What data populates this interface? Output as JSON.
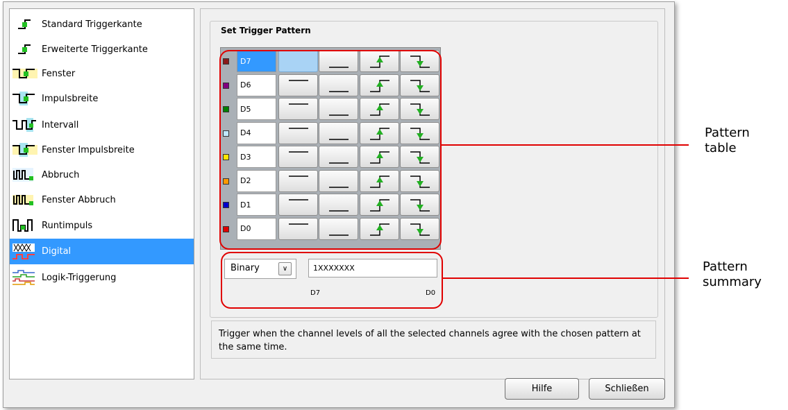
{
  "trigger_types": [
    {
      "label": "Standard Triggerkante",
      "icon": "standard-edge-icon"
    },
    {
      "label": "Erweiterte Triggerkante",
      "icon": "advanced-edge-icon"
    },
    {
      "label": "Fenster",
      "icon": "window-icon"
    },
    {
      "label": "Impulsbreite",
      "icon": "pulse-width-icon"
    },
    {
      "label": "Intervall",
      "icon": "interval-icon"
    },
    {
      "label": "Fenster Impulsbreite",
      "icon": "window-pulse-width-icon"
    },
    {
      "label": "Abbruch",
      "icon": "dropout-icon"
    },
    {
      "label": "Fenster Abbruch",
      "icon": "window-dropout-icon"
    },
    {
      "label": "Runtimpuls",
      "icon": "runt-pulse-icon"
    },
    {
      "label": "Digital",
      "icon": "digital-icon",
      "selected": true
    },
    {
      "label": "Logik-Triggerung",
      "icon": "logic-trigger-icon"
    }
  ],
  "pattern": {
    "group_title": "Set Trigger Pattern",
    "channels": [
      {
        "name": "D7",
        "color": "#8b1a1a",
        "selected": true,
        "state": "high-blank"
      },
      {
        "name": "D6",
        "color": "#800080"
      },
      {
        "name": "D5",
        "color": "#008000"
      },
      {
        "name": "D4",
        "color": "#c0e8ff"
      },
      {
        "name": "D3",
        "color": "#ffe600"
      },
      {
        "name": "D2",
        "color": "#ff9900"
      },
      {
        "name": "D1",
        "color": "#0000cc"
      },
      {
        "name": "D0",
        "color": "#e00000"
      }
    ],
    "button_icons": [
      "high-level-icon",
      "low-level-icon",
      "rising-edge-icon",
      "falling-edge-icon"
    ]
  },
  "summary": {
    "format": "Binary",
    "value": "1XXXXXXX",
    "msb_label": "D7",
    "lsb_label": "D0"
  },
  "description": "Trigger when the channel levels of all the selected channels agree with the chosen pattern at the same time.",
  "buttons": {
    "help": "Hilfe",
    "close": "Schließen"
  },
  "annotations": {
    "pattern_table": [
      "Pattern",
      "table"
    ],
    "pattern_summary": [
      "Pattern",
      "summary"
    ],
    "color": "#e00000"
  }
}
